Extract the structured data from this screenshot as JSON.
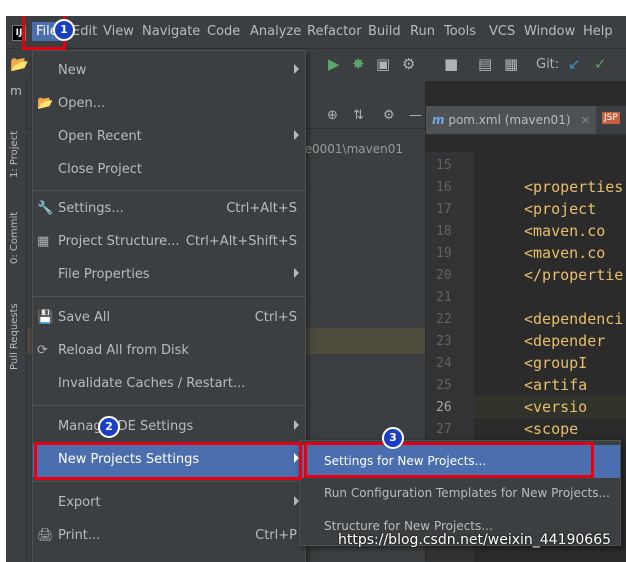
{
  "menubar": {
    "logo": "IJ",
    "items": [
      "File",
      "Edit",
      "View",
      "Navigate",
      "Code",
      "Analyze",
      "Refactor",
      "Build",
      "Run",
      "Tools",
      "VCS",
      "Window",
      "Help"
    ]
  },
  "toolbar": {
    "git_label": "Git:"
  },
  "project": {
    "path": "ce0001\\maven01"
  },
  "sidebar": {
    "project_tab": "1: Project",
    "commit_tab": "0: Commit",
    "pr_tab": "Pull Requests"
  },
  "editor": {
    "tab_label": "pom.xml (maven01)",
    "line_numbers": [
      "15",
      "16",
      "17",
      "18",
      "19",
      "20",
      "21",
      "22",
      "23",
      "24",
      "25",
      "26",
      "27"
    ],
    "code_lines": [
      "",
      "<properties",
      "  <project",
      "  <maven.co",
      "  <maven.co",
      "</propertie",
      "",
      "<dependenci",
      "  <depender",
      "    <groupI",
      "    <artifa",
      "    <versio",
      "    <scope"
    ]
  },
  "file_menu": {
    "items": [
      {
        "label": "New",
        "shortcut": "",
        "submenu": true,
        "icon": ""
      },
      {
        "label": "Open...",
        "shortcut": "",
        "submenu": false,
        "icon": "folder-icon"
      },
      {
        "label": "Open Recent",
        "shortcut": "",
        "submenu": true,
        "icon": ""
      },
      {
        "label": "Close Project",
        "shortcut": "",
        "submenu": false,
        "icon": ""
      },
      {
        "label": "Settings...",
        "shortcut": "Ctrl+Alt+S",
        "submenu": false,
        "icon": "wrench-icon"
      },
      {
        "label": "Project Structure...",
        "shortcut": "Ctrl+Alt+Shift+S",
        "submenu": false,
        "icon": "structure-icon"
      },
      {
        "label": "File Properties",
        "shortcut": "",
        "submenu": true,
        "icon": ""
      },
      {
        "label": "Save All",
        "shortcut": "Ctrl+S",
        "submenu": false,
        "icon": "save-icon"
      },
      {
        "label": "Reload All from Disk",
        "shortcut": "",
        "submenu": false,
        "icon": "reload-icon"
      },
      {
        "label": "Invalidate Caches / Restart...",
        "shortcut": "",
        "submenu": false,
        "icon": ""
      },
      {
        "label": "Manage IDE Settings",
        "shortcut": "",
        "submenu": true,
        "icon": ""
      },
      {
        "label": "New Projects Settings",
        "shortcut": "",
        "submenu": true,
        "icon": ""
      },
      {
        "label": "Export",
        "shortcut": "",
        "submenu": true,
        "icon": ""
      },
      {
        "label": "Print...",
        "shortcut": "Ctrl+P",
        "submenu": false,
        "icon": "print-icon"
      }
    ]
  },
  "submenu": {
    "items": [
      "Settings for New Projects...",
      "Run Configuration Templates for New Projects...",
      "Structure for New Projects..."
    ]
  },
  "annotations": {
    "badge1": "1",
    "badge2": "2",
    "badge3": "3",
    "color": "#e60012"
  },
  "watermark": "https://blog.csdn.net/weixin_44190665"
}
